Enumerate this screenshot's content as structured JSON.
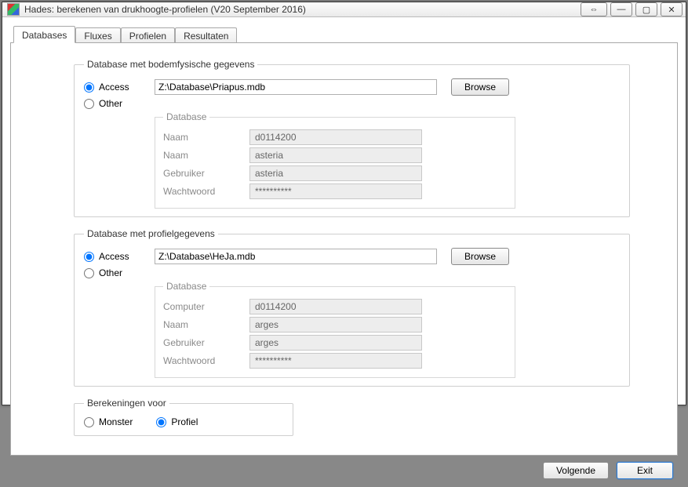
{
  "window": {
    "title": "Hades: berekenen van drukhoogte-profielen (V20 September 2016)",
    "buttons": {
      "back_fwd": "⇔",
      "min": "—",
      "max": "▢",
      "close": "✕"
    }
  },
  "tabs": [
    "Databases",
    "Fluxes",
    "Profielen",
    "Resultaten"
  ],
  "active_tab": 0,
  "db1": {
    "legend": "Database met bodemfysische gegevens",
    "access_label": "Access",
    "other_label": "Other",
    "selected": "access",
    "path": "Z:\\Database\\Priapus.mdb",
    "browse": "Browse",
    "inner_legend": "Database",
    "fields": {
      "naam1_label": "Naam",
      "naam1_value": "d0114200",
      "naam2_label": "Naam",
      "naam2_value": "asteria",
      "gebruiker_label": "Gebruiker",
      "gebruiker_value": "asteria",
      "wachtwoord_label": "Wachtwoord",
      "wachtwoord_value": "**********"
    }
  },
  "db2": {
    "legend": "Database met profielgegevens",
    "access_label": "Access",
    "other_label": "Other",
    "selected": "access",
    "path": "Z:\\Database\\HeJa.mdb",
    "browse": "Browse",
    "inner_legend": "Database",
    "fields": {
      "computer_label": "Computer",
      "computer_value": "d0114200",
      "naam_label": "Naam",
      "naam_value": "arges",
      "gebruiker_label": "Gebruiker",
      "gebruiker_value": "arges",
      "wachtwoord_label": "Wachtwoord",
      "wachtwoord_value": "**********"
    }
  },
  "calc": {
    "legend": "Berekeningen voor",
    "monster_label": "Monster",
    "profiel_label": "Profiel",
    "selected": "profiel"
  },
  "footer": {
    "next": "Volgende",
    "exit": "Exit"
  }
}
